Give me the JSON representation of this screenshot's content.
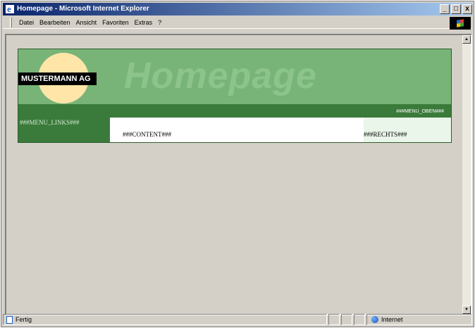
{
  "window": {
    "title": "Homepage - Microsoft Internet Explorer",
    "controls": [
      "_",
      "□",
      "x"
    ]
  },
  "menu": {
    "items": [
      "Datei",
      "Bearbeiten",
      "Ansicht",
      "Favoriten",
      "Extras",
      "?"
    ]
  },
  "page": {
    "company": "MUSTERMANN AG",
    "title": "Homepage",
    "nav_placeholder": "###MENU_OBEN###",
    "left_placeholder": "###MENU_LINKS###",
    "content_placeholder": "###CONTENT###",
    "right_placeholder": "###RECHTS###"
  },
  "status": {
    "text": "Fertig",
    "zone": "Internet"
  },
  "scrollbar": {
    "up": "▲",
    "down": "▼"
  }
}
